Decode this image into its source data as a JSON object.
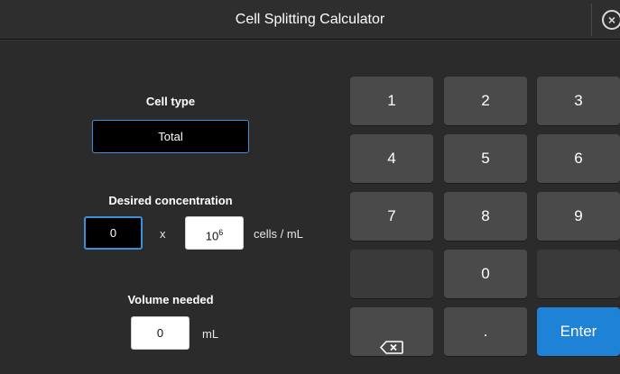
{
  "window": {
    "title": "Cell Splitting Calculator"
  },
  "form": {
    "cell_type_label": "Cell type",
    "cell_type_value": "Total",
    "concentration_label": "Desired concentration",
    "concentration_value": "0",
    "times_symbol": "x",
    "exponent_base": "10",
    "exponent_power": "6",
    "concentration_unit": "cells / mL",
    "volume_label": "Volume needed",
    "volume_value": "0",
    "volume_unit": "mL"
  },
  "keypad": {
    "k1": "1",
    "k2": "2",
    "k3": "3",
    "k4": "4",
    "k5": "5",
    "k6": "6",
    "k7": "7",
    "k8": "8",
    "k9": "9",
    "k0": "0",
    "dot": ".",
    "enter": "Enter",
    "backspace_icon": "backspace-icon"
  },
  "colors": {
    "accent": "#1e82d6",
    "focus_border": "#3a91d9",
    "key": "#4a4a4a",
    "background": "#2b2b2b"
  }
}
